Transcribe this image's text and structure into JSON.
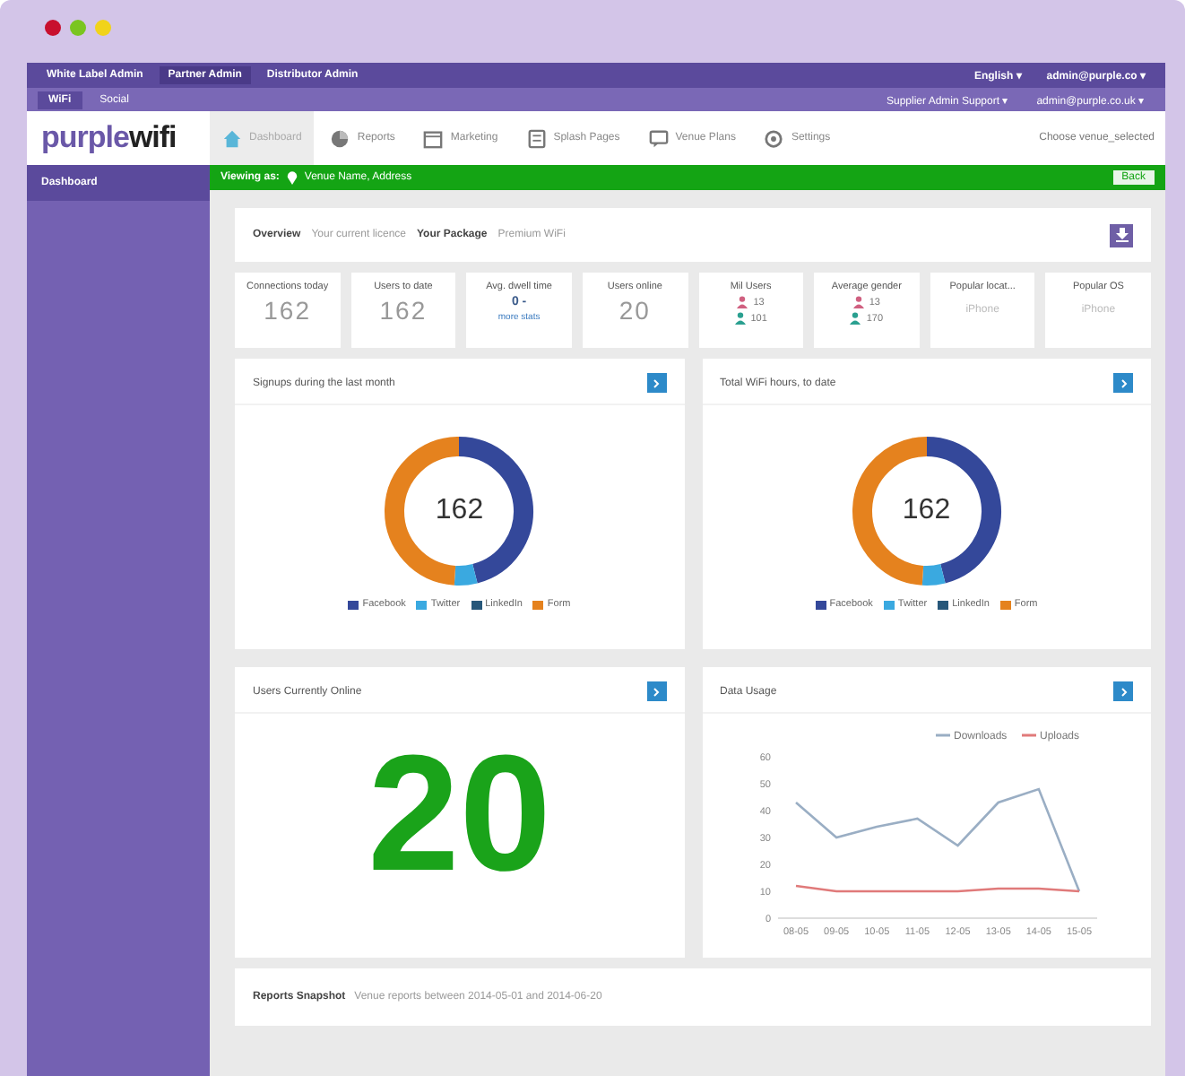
{
  "top_bar": {
    "links": [
      {
        "label": "White Label Admin",
        "selected": false
      },
      {
        "label": "Partner Admin",
        "selected": true
      },
      {
        "label": "Distributor Admin",
        "selected": false
      }
    ],
    "language": "English ▾",
    "account": "admin@purple.co ▾"
  },
  "sub_bar": {
    "tabs": [
      {
        "label": "WiFi",
        "selected": true
      },
      {
        "label": "Social",
        "selected": false
      }
    ],
    "right": [
      "Supplier Admin Support ▾",
      "admin@purple.co.uk ▾"
    ]
  },
  "logo": {
    "part1": "purple",
    "part2": "wifi"
  },
  "nav": [
    {
      "label": "Dashboard",
      "kind": "home",
      "selected": true
    },
    {
      "label": "Reports",
      "kind": "pie",
      "selected": false
    },
    {
      "label": "Marketing",
      "kind": "calendar",
      "selected": false
    },
    {
      "label": "Splash Pages",
      "kind": "page",
      "selected": false
    },
    {
      "label": "Venue Plans",
      "kind": "chat",
      "selected": false
    },
    {
      "label": "Settings",
      "kind": "gear",
      "selected": false
    }
  ],
  "venue_select": "Choose venue_selected",
  "sidebar": {
    "items": [
      {
        "label": "Dashboard",
        "selected": true
      }
    ]
  },
  "viewing": {
    "label": "Viewing as:",
    "venue": "Venue Name, Address",
    "button": "Back"
  },
  "overview": {
    "label": "Overview",
    "value": "Your current licence",
    "package_label": "Your Package",
    "package": "Premium WiFi"
  },
  "stats": [
    {
      "label": "Connections today",
      "value": "162",
      "kind": "number"
    },
    {
      "label": "Users to date",
      "value": "162",
      "kind": "number"
    },
    {
      "label": "Avg. dwell time",
      "value": "0 -",
      "sub": "more stats",
      "kind": "time"
    },
    {
      "label": "Users online",
      "value": "20",
      "kind": "number"
    },
    {
      "label": "Mil Users",
      "male": "13",
      "female": "101",
      "kind": "gender"
    },
    {
      "label": "Average gender",
      "male": "13",
      "female": "170",
      "kind": "gender"
    },
    {
      "label": "Popular locat...",
      "value": "iPhone",
      "kind": "muted"
    },
    {
      "label": "Popular OS",
      "value": "iPhone",
      "kind": "muted"
    }
  ],
  "donuts": [
    {
      "title": "Signups during the last month",
      "center": "162",
      "legend": [
        {
          "label": "Facebook",
          "color": "#34489a"
        },
        {
          "label": "Twitter",
          "color": "#3aa9e0"
        },
        {
          "label": "LinkedIn",
          "color": "#27577a"
        },
        {
          "label": "Form",
          "color": "#e5821e"
        }
      ]
    },
    {
      "title": "Total WiFi hours, to date",
      "center": "162",
      "legend": [
        {
          "label": "Facebook",
          "color": "#34489a"
        },
        {
          "label": "Twitter",
          "color": "#3aa9e0"
        },
        {
          "label": "LinkedIn",
          "color": "#27577a"
        },
        {
          "label": "Form",
          "color": "#e5821e"
        }
      ]
    }
  ],
  "online": {
    "title": "Users Currently Online",
    "value": "20"
  },
  "usage": {
    "title": "Data Usage",
    "chart_data": {
      "type": "line",
      "legend": "top-right",
      "categories": [
        "08-05",
        "09-05",
        "10-05",
        "11-05",
        "12-05",
        "13-05",
        "14-05",
        "15-05"
      ],
      "yticks": [
        0,
        10,
        20,
        30,
        40,
        50,
        60
      ],
      "ylim": [
        0,
        60
      ],
      "series": [
        {
          "name": "Downloads",
          "color": "#9aaec4",
          "values": [
            43,
            30,
            34,
            37,
            27,
            43,
            48,
            10
          ]
        },
        {
          "name": "Uploads",
          "color": "#e07a7a",
          "values": [
            12,
            10,
            10,
            10,
            10,
            11,
            11,
            10
          ]
        }
      ]
    }
  },
  "footer": {
    "label": "Reports Snapshot",
    "value": "Venue reports between 2014-05-01 and 2014-06-20"
  }
}
